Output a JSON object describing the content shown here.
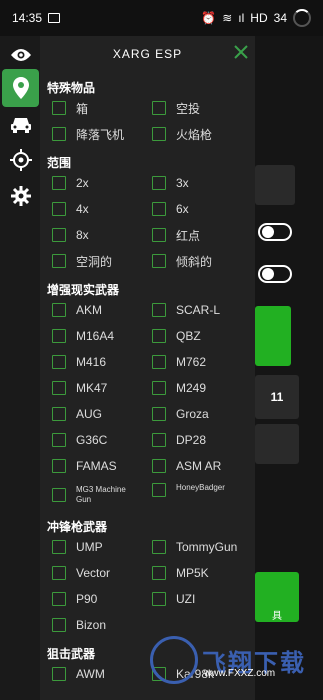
{
  "status": {
    "time": "14:35",
    "battery": "34",
    "net": "HD"
  },
  "panel": {
    "title": "XARG ESP"
  },
  "sections": [
    {
      "title": "特殊物品",
      "items": [
        "箱",
        "空投",
        "降落飞机",
        "火焰枪"
      ]
    },
    {
      "title": "范围",
      "items": [
        "2x",
        "3x",
        "4x",
        "6x",
        "8x",
        "红点",
        "空洞的",
        "倾斜的"
      ]
    },
    {
      "title": "增强现实武器",
      "items": [
        "AKM",
        "SCAR-L",
        "M16A4",
        "QBZ",
        "M416",
        "M762",
        "MK47",
        "M249",
        "AUG",
        "Groza",
        "G36C",
        "DP28",
        "FAMAS",
        "ASM AR",
        "MG3 Machine Gun",
        "HoneyBadger"
      ]
    },
    {
      "title": "冲锋枪武器",
      "items": [
        "UMP",
        "TommyGun",
        "Vector",
        "MP5K",
        "P90",
        "UZI",
        "Bizon"
      ]
    },
    {
      "title": "狙击武器",
      "items": [
        "AWM",
        "Kar98k"
      ]
    }
  ],
  "right": {
    "number": "11",
    "green_label": "具"
  },
  "watermark": {
    "text": "飞翔下载",
    "url": "www.FXXZ.com"
  },
  "colors": {
    "accent": "#3aa04a",
    "checkbox": "#3c9a3c",
    "panel": "#222222"
  }
}
